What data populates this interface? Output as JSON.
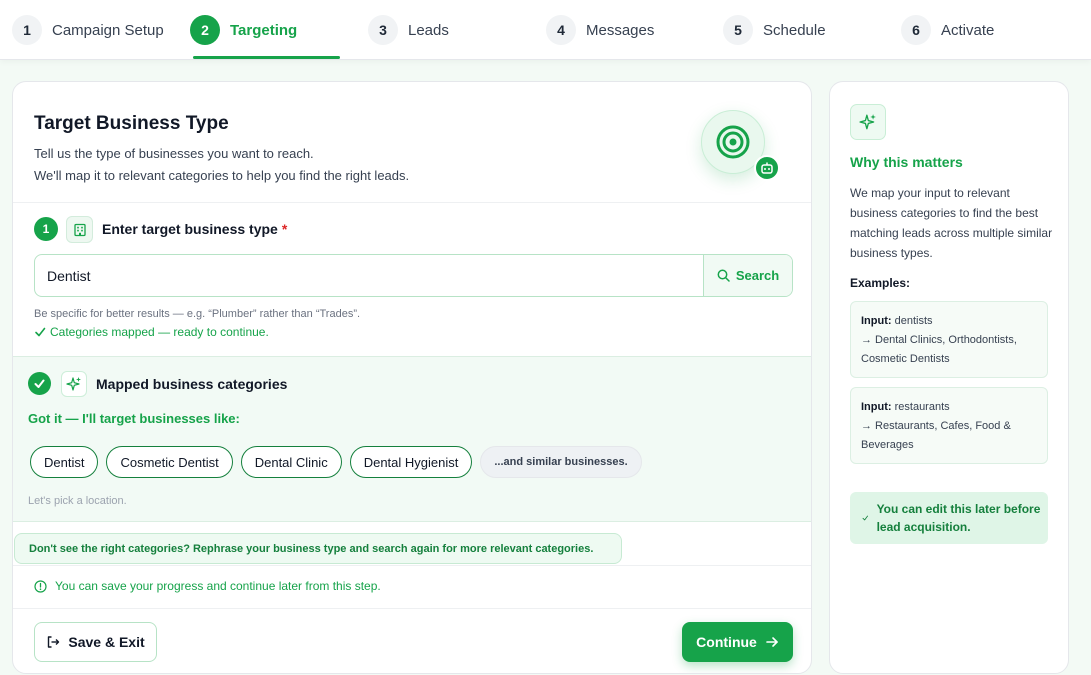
{
  "stepper": {
    "steps": [
      {
        "num": "1",
        "label": "Campaign Setup"
      },
      {
        "num": "2",
        "label": "Targeting"
      },
      {
        "num": "3",
        "label": "Leads"
      },
      {
        "num": "4",
        "label": "Messages"
      },
      {
        "num": "5",
        "label": "Schedule"
      },
      {
        "num": "6",
        "label": "Activate"
      }
    ],
    "active_index": 1
  },
  "main": {
    "title": "Target Business Type",
    "desc_line1": "Tell us the type of businesses you want to reach.",
    "desc_line2": "We'll map it to relevant categories to help you find the right leads.",
    "field": {
      "step": "1",
      "label": "Enter target business type",
      "required_mark": "*",
      "value": "Dentist",
      "search_label": "Search"
    },
    "hint": "Be specific for better results — e.g. “Plumber” rather than “Trades”.",
    "ok_message": "Categories mapped — ready to continue.",
    "mapped": {
      "title": "Mapped business categories",
      "intro": "Got it — I'll target businesses like:",
      "categories": [
        "Dentist",
        "Cosmetic Dentist",
        "Dental Clinic",
        "Dental Hygienist"
      ],
      "more": "...and similar businesses.",
      "next_hint": "Let's pick a location."
    },
    "tip": "Don't see the right categories? Rephrase your business type and search again for more relevant categories.",
    "save_note": "You can save your progress and continue later from this step.",
    "save_exit_label": "Save & Exit",
    "continue_label": "Continue"
  },
  "side": {
    "title": "Why this matters",
    "text": "We map your input to relevant business categories to find the best matching leads across multiple similar business types.",
    "examples_label": "Examples:",
    "examples": [
      {
        "input_label": "Input:",
        "input": "dentists",
        "output": "→ Dental Clinics, Orthodontists, Cosmetic Dentists"
      },
      {
        "input_label": "Input:",
        "input": "restaurants",
        "output": "→ Restaurants, Cafes, Food & Beverages"
      }
    ],
    "edit_note": "You can edit this later before lead acquisition."
  },
  "colors": {
    "accent": "#16a34a",
    "accent_dark": "#15803d",
    "soft_bg": "#f2faf5",
    "required": "#dc2626"
  }
}
